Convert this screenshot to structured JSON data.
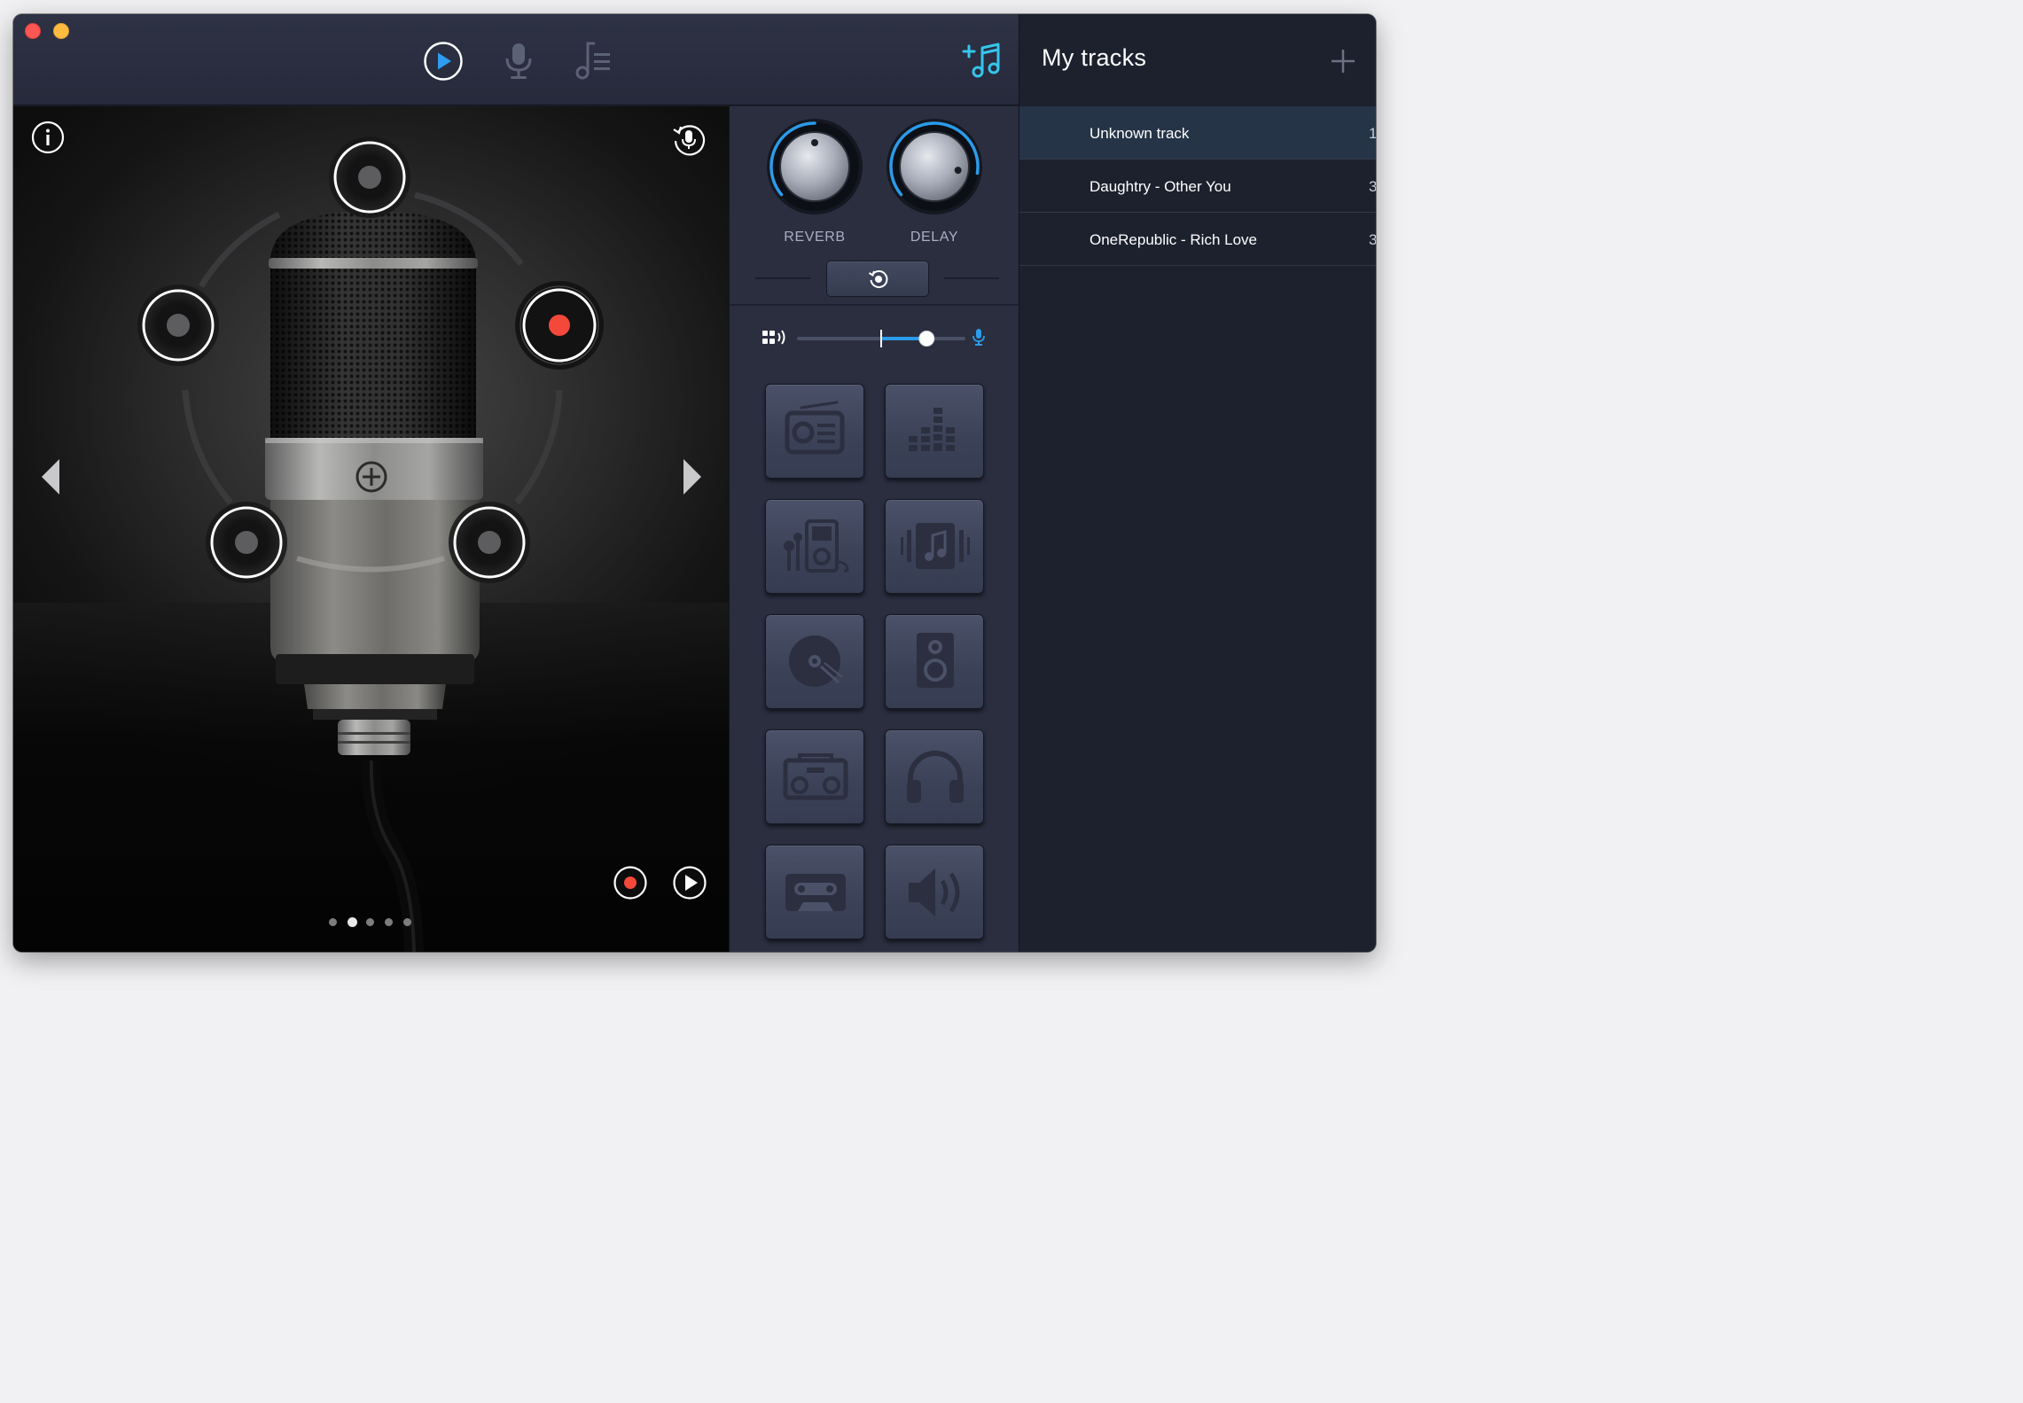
{
  "window": {
    "traffic_colors": {
      "close": "#fc5753",
      "minimize": "#fdbc40"
    }
  },
  "toolbar": {
    "tabs": [
      {
        "id": "play",
        "icon": "play-circle-icon",
        "active": true
      },
      {
        "id": "microphone",
        "icon": "microphone-icon",
        "active": false
      },
      {
        "id": "playlist",
        "icon": "music-list-icon",
        "active": false
      }
    ],
    "add_music_icon": "add-music-icon",
    "accent_color": "#35c6ec"
  },
  "sidebar": {
    "title": "My tracks",
    "add_icon": "plus-icon",
    "tracks": [
      {
        "name": "Unknown track",
        "count": "1",
        "selected": true
      },
      {
        "name": "Daughtry - Other You",
        "count": "3",
        "selected": false
      },
      {
        "name": "OneRepublic - Rich Love",
        "count": "3",
        "selected": false
      }
    ]
  },
  "stage": {
    "voice_effects": [
      {
        "position": "top",
        "selected": false
      },
      {
        "position": "upper-left",
        "selected": false
      },
      {
        "position": "upper-right",
        "selected": true
      },
      {
        "position": "lower-left",
        "selected": false
      },
      {
        "position": "lower-right",
        "selected": false
      }
    ],
    "selected_color": "#f4483b",
    "pager": {
      "count": 5,
      "active_index": 1
    }
  },
  "effects": {
    "reverb": {
      "label": "REVERB",
      "value": 0.5
    },
    "delay": {
      "label": "DELAY",
      "value": 0.88
    },
    "knob_color": "#2b9bea",
    "mix": {
      "value": 0.77,
      "center": 0.5,
      "color": "#2b9bea"
    },
    "presets": [
      {
        "icon": "radio-icon"
      },
      {
        "icon": "equalizer-icon"
      },
      {
        "icon": "music-player-icon"
      },
      {
        "icon": "music-album-icon"
      },
      {
        "icon": "vinyl-disc-icon"
      },
      {
        "icon": "speaker-icon"
      },
      {
        "icon": "boombox-icon"
      },
      {
        "icon": "headphones-icon"
      },
      {
        "icon": "cassette-icon"
      },
      {
        "icon": "volume-icon"
      }
    ]
  }
}
